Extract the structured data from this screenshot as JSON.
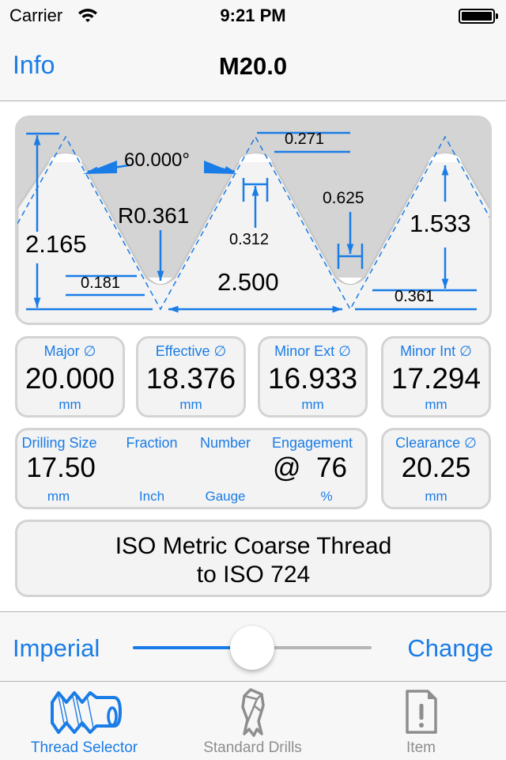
{
  "status_bar": {
    "carrier": "Carrier",
    "time": "9:21 PM",
    "wifi_icon": "wifi-icon",
    "battery_icon": "battery-full-icon"
  },
  "nav": {
    "left_button": "Info",
    "title": "M20.0"
  },
  "diagram": {
    "angle": "60.000°",
    "root_radius": "R0.361",
    "thread_height": "2.165",
    "root_truncation": "0.181",
    "pitch": "2.500",
    "crest_flat_top": "0.271",
    "crest_width": "0.312",
    "root_width": "0.625",
    "engagement_depth": "1.533",
    "root_offset": "0.361"
  },
  "diameters": [
    {
      "label": "Major ∅",
      "value": "20.000",
      "unit": "mm"
    },
    {
      "label": "Effective ∅",
      "value": "18.376",
      "unit": "mm"
    },
    {
      "label": "Minor Ext ∅",
      "value": "16.933",
      "unit": "mm"
    },
    {
      "label": "Minor Int ∅",
      "value": "17.294",
      "unit": "mm"
    }
  ],
  "drilling": {
    "drill_label": "Drilling Size",
    "drill_value": "17.50",
    "drill_unit": "mm",
    "fraction_label": "Fraction",
    "fraction_value": "",
    "fraction_unit": "Inch",
    "number_label": "Number",
    "number_value": "",
    "number_unit": "Gauge",
    "engagement_label": "Engagement",
    "engagement_value": "@  76",
    "engagement_unit": "%"
  },
  "clearance": {
    "label": "Clearance ∅",
    "value": "20.25",
    "unit": "mm"
  },
  "description": {
    "line1": "ISO Metric Coarse Thread",
    "line2": "to ISO 724"
  },
  "controls": {
    "left_label": "Imperial",
    "right_label": "Change",
    "slider_value": 0.5
  },
  "tabs": [
    {
      "label": "Thread Selector",
      "icon": "thread-icon",
      "active": true
    },
    {
      "label": "Standard Drills",
      "icon": "drill-bit-icon",
      "active": false
    },
    {
      "label": "Item",
      "icon": "document-alert-icon",
      "active": false
    }
  ],
  "colors": {
    "accent": "#1a7ce6",
    "inactive": "#8e8e8e",
    "card_border": "#d3d3d3"
  }
}
